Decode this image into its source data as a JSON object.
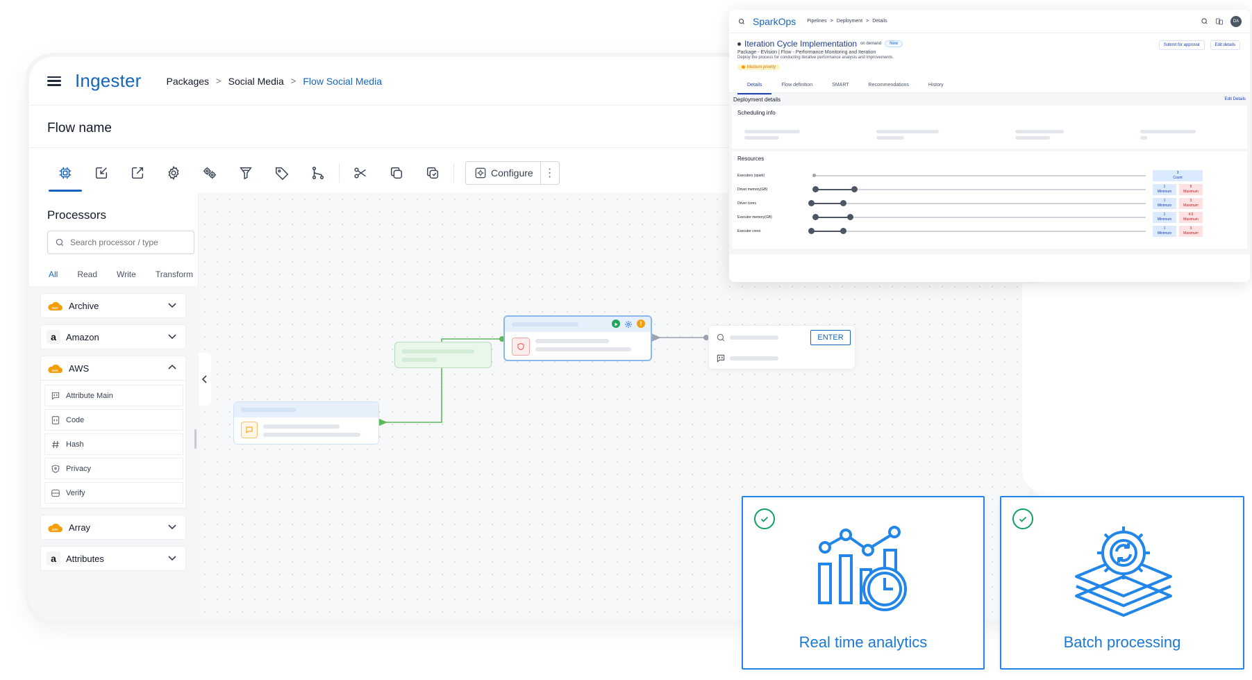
{
  "ingester": {
    "brand": "Ingester",
    "breadcrumb": [
      "Packages",
      "Social Media",
      "Flow Social Media"
    ],
    "flow_title": "Flow name",
    "toolbar": {
      "configure_label": "Configure"
    },
    "processors": {
      "title": "Processors",
      "search_placeholder": "Search processor / type",
      "tabs": [
        "All",
        "Read",
        "Write",
        "Transform"
      ],
      "groups": {
        "archive": "Archive",
        "amazon": "Amazon",
        "aws": "AWS",
        "array": "Array",
        "attributes": "Attributes"
      },
      "aws_items": [
        "Attribute Main",
        "Code",
        "Hash",
        "Privacy",
        "Verify"
      ]
    },
    "canvas": {
      "enter_label": "ENTER"
    }
  },
  "sparkops": {
    "brand": "SparkOps",
    "breadcrumb": [
      "Pipelines",
      "Deployment",
      "Details"
    ],
    "avatar": "DA",
    "title": "Iteration Cycle Implementation",
    "mode": "on demand",
    "new_badge": "New",
    "subtitle": "Package - EVision | Flow - Performance Monitoring and Iteration",
    "description": "Deploy the process for conducting iterative performance analysis and improvements.",
    "priority": "Medium priority",
    "actions": {
      "submit": "Submit for approval",
      "edit": "Edit details"
    },
    "tabs": [
      "Details",
      "Flow definition",
      "SMART",
      "Recommendations",
      "History"
    ],
    "deployment_details": "Deployment details",
    "edit_details_link": "Edit Details",
    "scheduling_info": "Scheduling info",
    "resources_title": "Resources",
    "resources": [
      {
        "label": "Executors (spark)",
        "value": "3",
        "value_caption": "Count",
        "min": null,
        "max": null
      },
      {
        "label": "Driver memory(GB)",
        "min": "1",
        "min_caption": "Minimum",
        "max": "5",
        "max_caption": "Maximum"
      },
      {
        "label": "Driver cores",
        "min": "1",
        "min_caption": "Minimum",
        "max": "3",
        "max_caption": "Maximum"
      },
      {
        "label": "Executor memory(GB)",
        "min": "1",
        "min_caption": "Minimum",
        "max": "4.5",
        "max_caption": "Maximum"
      },
      {
        "label": "Executor cores",
        "min": "1",
        "min_caption": "Minimum",
        "max": "3",
        "max_caption": "Maximum"
      }
    ]
  },
  "features": {
    "realtime": "Real time analytics",
    "batch": "Batch processing"
  },
  "colors": {
    "brand_blue": "#1565c0",
    "feature_blue": "#1a78d6",
    "success_green": "#10a060",
    "edge_green": "#5cb85c",
    "warning_orange": "#f59e0b"
  }
}
